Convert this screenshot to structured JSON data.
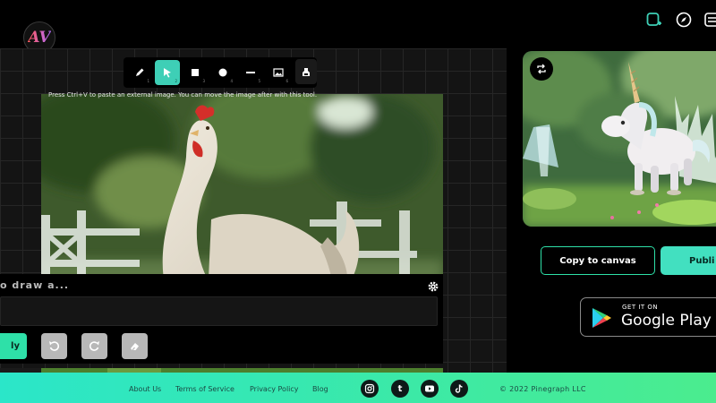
{
  "header": {
    "logo_text": "AV",
    "icons": [
      "new-canvas-icon",
      "compass-icon",
      "menu-icon"
    ]
  },
  "toolbar": {
    "tools": [
      {
        "icon": "pencil-icon",
        "key": "1"
      },
      {
        "icon": "cursor-icon",
        "key": "2",
        "active": true
      },
      {
        "icon": "square-icon",
        "key": "3"
      },
      {
        "icon": "circle-icon",
        "key": "4"
      },
      {
        "icon": "line-icon",
        "key": "5"
      },
      {
        "icon": "image-icon",
        "key": "6"
      },
      {
        "icon": "stamp-icon",
        "key": "7"
      }
    ],
    "hint": "Press Ctrl+V to paste an external image. You can move the image after with this tool."
  },
  "prompt": {
    "placeholder": "o draw a...",
    "apply_label": "ly"
  },
  "right_panel": {
    "copy_label": "Copy to canvas",
    "publish_label": "Publi",
    "google_play_small": "GET IT ON",
    "google_play_big": "Google Play"
  },
  "footer": {
    "links": [
      "About Us",
      "Terms of Service",
      "Privacy Policy",
      "Blog"
    ],
    "social": [
      "instagram-icon",
      "tumblr-icon",
      "youtube-icon",
      "tiktok-icon"
    ],
    "tumblr_letter": "t",
    "copyright": "© 2022 Pinegraph LLC"
  },
  "colors": {
    "accent": "#2ee0a8",
    "active_tool": "#3ecfb6",
    "footer_start": "#2be6c9",
    "footer_end": "#4bec8e"
  }
}
